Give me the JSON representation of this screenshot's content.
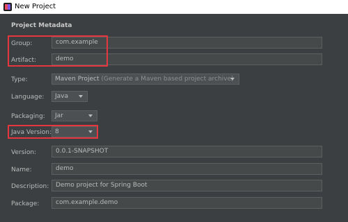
{
  "window": {
    "title": "New Project"
  },
  "section": {
    "title": "Project Metadata"
  },
  "fields": {
    "group": {
      "label": "Group:",
      "value": "com.example"
    },
    "artifact": {
      "label": "Artifact:",
      "value": "demo"
    },
    "type": {
      "label": "Type:",
      "value": "Maven Project",
      "hint": "(Generate a Maven based project archive)"
    },
    "language": {
      "label": "Language:",
      "value": "Java"
    },
    "packaging": {
      "label": "Packaging:",
      "value": "Jar"
    },
    "java_version": {
      "label": "Java Version:",
      "value": "8"
    },
    "version": {
      "label": "Version:",
      "value": "0.0.1-SNAPSHOT"
    },
    "name": {
      "label": "Name:",
      "value": "demo"
    },
    "description": {
      "label": "Description:",
      "value": "Demo project for Spring Boot"
    },
    "package": {
      "label": "Package:",
      "value": "com.example.demo"
    }
  },
  "colors": {
    "background": "#3c3f41",
    "highlight": "#e8363f",
    "field": "#45494a"
  }
}
